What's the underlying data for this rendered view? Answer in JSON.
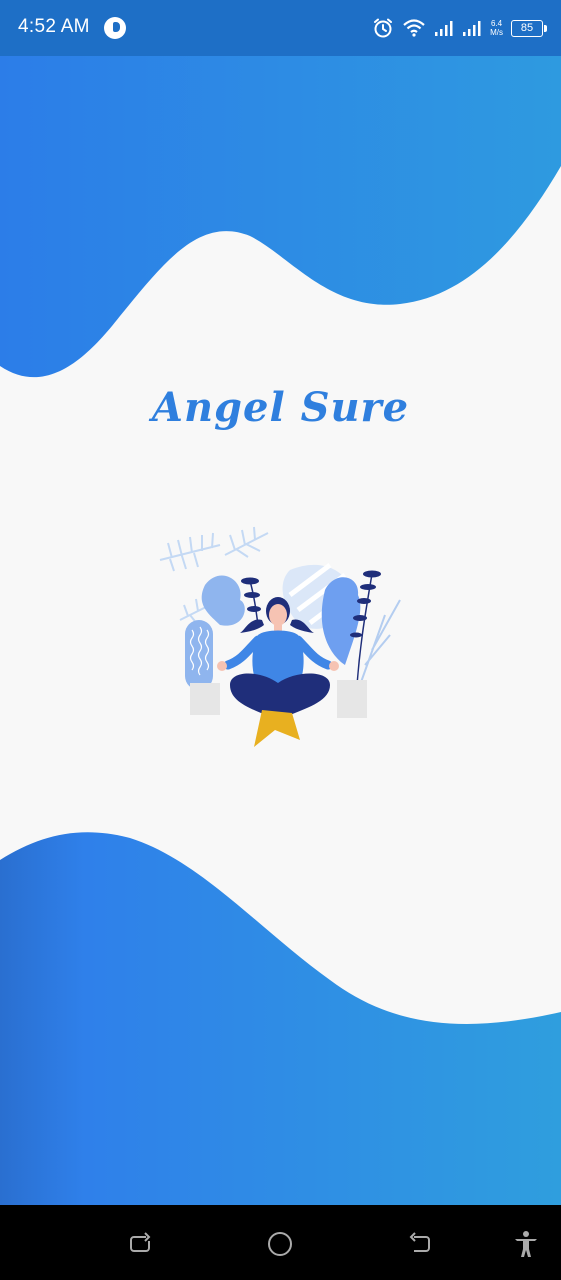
{
  "status_bar": {
    "time": "4:52 AM",
    "speed_value": "6.4",
    "speed_unit": "M/s",
    "battery": "85"
  },
  "splash": {
    "title": "Angel Sure"
  },
  "colors": {
    "primary": "#2f7fde",
    "status_bar": "#1e6fc6",
    "background": "#f8f8f8",
    "nav_bar": "#000000"
  },
  "icons": {
    "status": [
      "app-icon",
      "alarm-icon",
      "wifi-icon",
      "signal-icon",
      "signal-icon-2",
      "battery-icon"
    ],
    "nav": [
      "recent-apps-icon",
      "home-icon",
      "back-icon",
      "accessibility-icon"
    ]
  }
}
